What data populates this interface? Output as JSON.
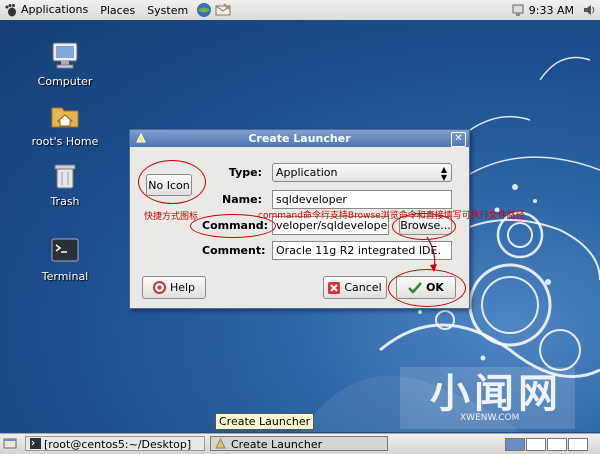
{
  "top_panel": {
    "menus": [
      "Applications",
      "Places",
      "System"
    ],
    "clock": "9:33 AM"
  },
  "desktop_icons": [
    {
      "label": "Computer"
    },
    {
      "label": "root's Home"
    },
    {
      "label": "Trash"
    },
    {
      "label": "Terminal"
    }
  ],
  "dialog": {
    "title": "Create Launcher",
    "no_icon_label": "No Icon",
    "type_label": "Type:",
    "type_value": "Application",
    "name_label": "Name:",
    "name_value": "sqldeveloper",
    "command_label": "Command:",
    "command_value": "veloper/sqldeveloper.sh",
    "browse_label": "Browse...",
    "comment_label": "Comment:",
    "comment_value": "Oracle 11g R2 integrated IDE.",
    "help_label": "Help",
    "cancel_label": "Cancel",
    "ok_label": "OK"
  },
  "annotations": {
    "icon_note": "快捷方式图标",
    "command_note": "command命令行支持Browse浏览命令和直接填写可执行文件路径"
  },
  "taskbar": {
    "terminal_task": "[root@centos5:~/Desktop]",
    "launcher_task": "Create Launcher",
    "tooltip": "Create Launcher"
  },
  "watermark": {
    "text": "小闻网",
    "sub": "XWENW.COM"
  },
  "colors": {
    "annotation": "#cc0000",
    "title_bar": "#5b82be"
  }
}
